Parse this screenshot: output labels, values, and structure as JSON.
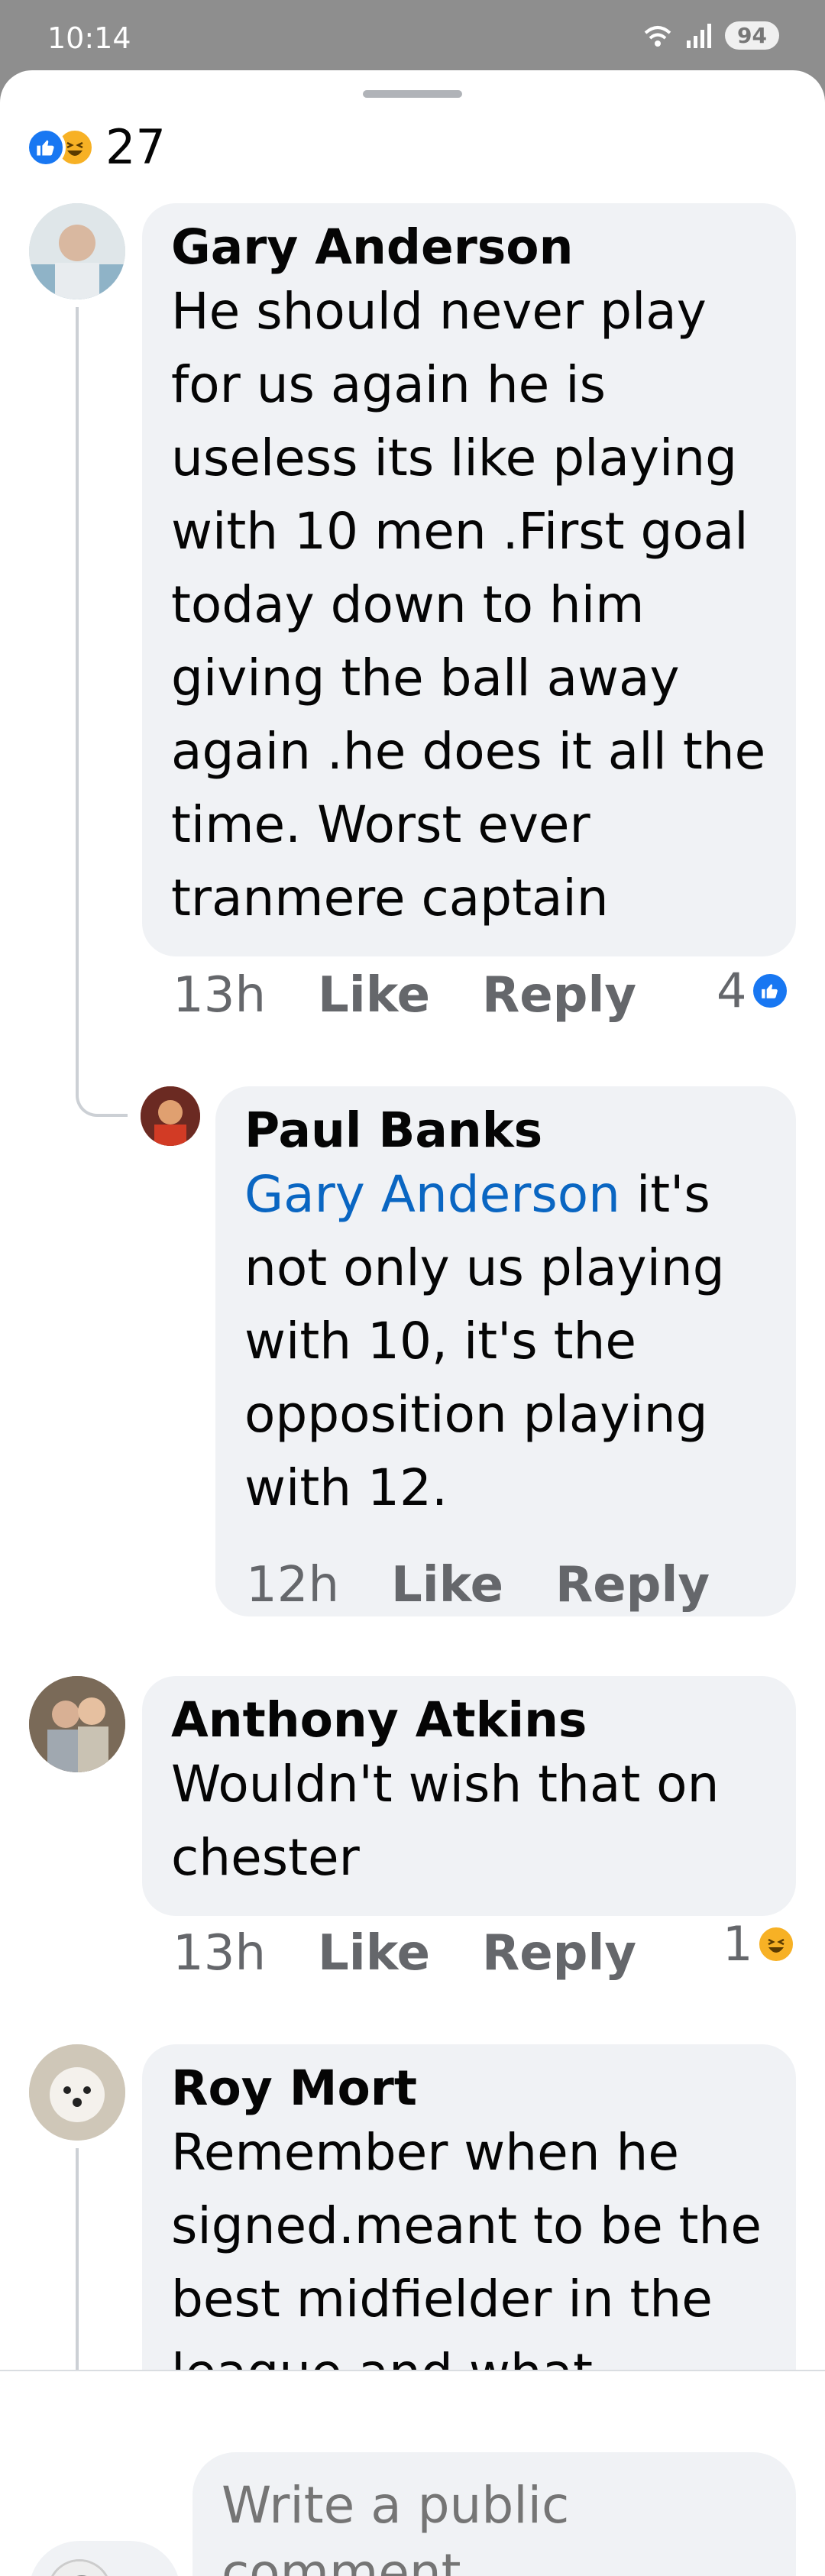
{
  "status_bar": {
    "time": "10:14",
    "battery": "94"
  },
  "reactions_summary": {
    "count": "27"
  },
  "comments": [
    {
      "author": "Gary Anderson",
      "text": "He should never play for us again he is useless its like playing with 10 men .First goal today down to him giving the ball away again .he does it all the time. Worst ever tranmere captain",
      "time": "13h",
      "like_label": "Like",
      "reply_label": "Reply",
      "reaction_count": "4",
      "reaction_type": "like-icon"
    },
    {
      "author": "Paul Banks",
      "mention": "Gary Anderson",
      "text": " it's not only us playing with 10, it's the opposition playing with 12.",
      "time": "12h",
      "like_label": "Like",
      "reply_label": "Reply"
    },
    {
      "author": "Anthony Atkins",
      "text": "Wouldn't wish that on chester",
      "time": "13h",
      "like_label": "Like",
      "reply_label": "Reply",
      "reaction_count": "1",
      "reaction_type": "haha-icon"
    },
    {
      "author": "Roy Mort",
      "text": "Remember when he signed.meant to be the best midfielder in the league and what"
    }
  ],
  "composer": {
    "placeholder": "Write a public comment..."
  },
  "colors": {
    "like_blue": "#1877f2",
    "haha_yellow": "#f7b125",
    "mention_blue": "#0a66c2",
    "bubble": "#f0f2f5"
  }
}
